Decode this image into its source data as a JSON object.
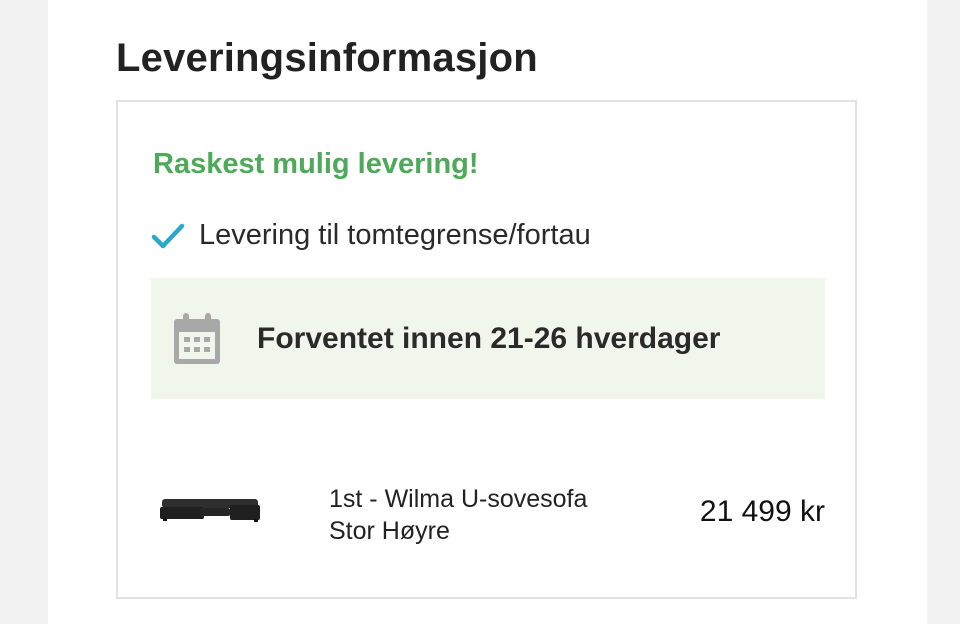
{
  "delivery": {
    "title": "Leveringsinformasjon",
    "fast_label": "Raskest mulig levering!",
    "feature": "Levering til tomtegrense/fortau",
    "eta": "Forventet innen 21-26 hverdager"
  },
  "product": {
    "name": "1st - Wilma U-sovesofa Stor Høyre",
    "price": "21 499 kr",
    "image_icon": "sofa-image"
  },
  "colors": {
    "accent_green": "#4caa59",
    "check_blue": "#2aa7c9",
    "eta_background": "#f1f6ec"
  }
}
